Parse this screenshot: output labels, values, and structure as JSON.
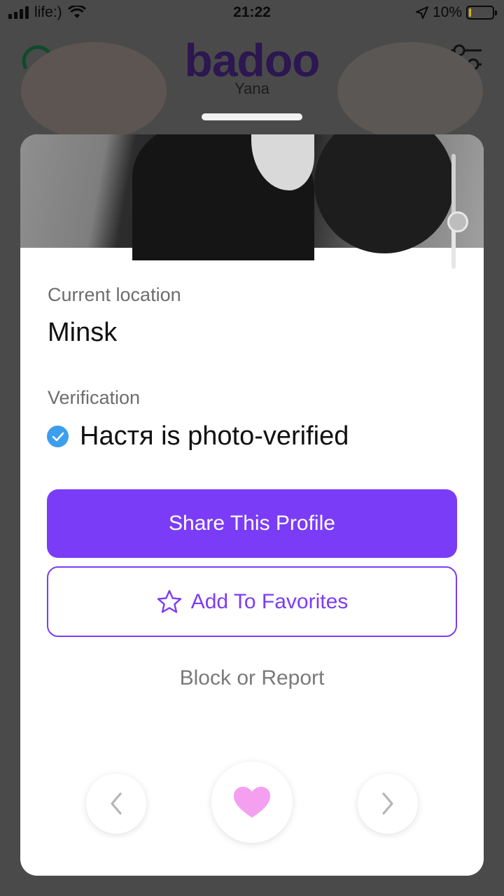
{
  "status_bar": {
    "carrier": "life:)",
    "time": "21:22",
    "battery_percent": "10%",
    "battery_level": 0.1
  },
  "header": {
    "logo": "badoo",
    "icons": [
      "speedometer-icon",
      "filter-sliders-icon"
    ],
    "background_profile_name": "Yana"
  },
  "profile": {
    "location_label": "Current location",
    "location_value": "Minsk",
    "verification_label": "Verification",
    "verification_value": "Настя is photo-verified"
  },
  "actions": {
    "share_label": "Share This Profile",
    "favorites_label": "Add To Favorites",
    "block_label": "Block or Report"
  },
  "navigation": {
    "prev_icon": "chevron-left-icon",
    "like_icon": "heart-icon",
    "next_icon": "chevron-right-icon"
  },
  "colors": {
    "brand": "#2c1751",
    "accent": "#7b3cf7",
    "verified": "#3c9eed",
    "heart": "#f49ff0"
  }
}
